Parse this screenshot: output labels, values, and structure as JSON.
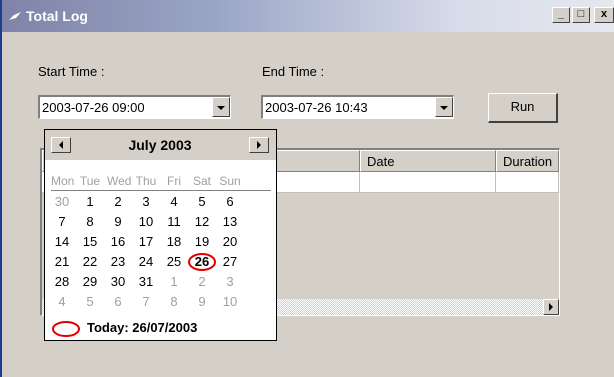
{
  "window": {
    "title": "Total Log",
    "minimize": "_",
    "maximize": "□",
    "close": "x"
  },
  "form": {
    "start_label": "Start Time :",
    "end_label": "End Time :",
    "start_value": "2003-07-26 09:00",
    "end_value": "2003-07-26 10:43",
    "run_label": "Run"
  },
  "grid": {
    "columns": [
      "",
      "",
      "Date",
      "Duration"
    ]
  },
  "calendar": {
    "month_title": "July 2003",
    "weekdays": [
      "Mon",
      "Tue",
      "Wed",
      "Thu",
      "Fri",
      "Sat",
      "Sun"
    ],
    "weeks": [
      [
        {
          "d": "30",
          "other": true
        },
        {
          "d": "1"
        },
        {
          "d": "2"
        },
        {
          "d": "3"
        },
        {
          "d": "4"
        },
        {
          "d": "5"
        },
        {
          "d": "6"
        }
      ],
      [
        {
          "d": "7"
        },
        {
          "d": "8"
        },
        {
          "d": "9"
        },
        {
          "d": "10"
        },
        {
          "d": "11"
        },
        {
          "d": "12"
        },
        {
          "d": "13"
        }
      ],
      [
        {
          "d": "14"
        },
        {
          "d": "15"
        },
        {
          "d": "16"
        },
        {
          "d": "17"
        },
        {
          "d": "18"
        },
        {
          "d": "19"
        },
        {
          "d": "20"
        }
      ],
      [
        {
          "d": "21"
        },
        {
          "d": "22"
        },
        {
          "d": "23"
        },
        {
          "d": "24"
        },
        {
          "d": "25"
        },
        {
          "d": "26",
          "selected": true
        },
        {
          "d": "27"
        }
      ],
      [
        {
          "d": "28"
        },
        {
          "d": "29"
        },
        {
          "d": "30"
        },
        {
          "d": "31"
        },
        {
          "d": "1",
          "other": true
        },
        {
          "d": "2",
          "other": true
        },
        {
          "d": "3",
          "other": true
        }
      ],
      [
        {
          "d": "4",
          "other": true
        },
        {
          "d": "5",
          "other": true
        },
        {
          "d": "6",
          "other": true
        },
        {
          "d": "7",
          "other": true
        },
        {
          "d": "8",
          "other": true
        },
        {
          "d": "9",
          "other": true
        },
        {
          "d": "10",
          "other": true
        }
      ]
    ],
    "today_text": "Today: 26/07/2003",
    "prev_icon": "arrow-left-icon",
    "next_icon": "arrow-right-icon"
  },
  "colors": {
    "titlebar_start": "#7f83a8",
    "window_bg": "#d4d0c8",
    "today_circle": "#e00000"
  }
}
